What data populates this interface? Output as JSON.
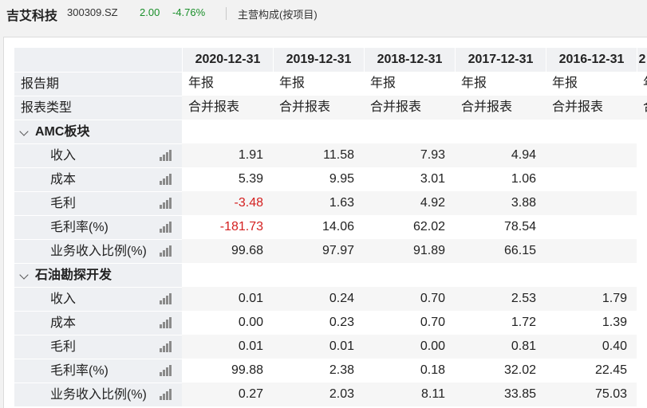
{
  "header": {
    "company": "吉艾科技",
    "code": "300309.SZ",
    "price": "2.00",
    "change": "-4.76%",
    "section": "主营构成(按项目)",
    "price_color": "#1a8f2a"
  },
  "table": {
    "periods": [
      "2020-12-31",
      "2019-12-31",
      "2018-12-31",
      "2017-12-31",
      "2016-12-31",
      "2"
    ],
    "report_period_label": "报告期",
    "report_period_values": [
      "年报",
      "年报",
      "年报",
      "年报",
      "年报",
      "年"
    ],
    "report_type_label": "报表类型",
    "report_type_values": [
      "合并报表",
      "合并报表",
      "合并报表",
      "合并报表",
      "合并报表",
      "合"
    ],
    "groups": [
      {
        "name": "AMC板块",
        "rows": [
          {
            "label": "收入",
            "values": [
              "1.91",
              "11.58",
              "7.93",
              "4.94",
              ""
            ]
          },
          {
            "label": "成本",
            "values": [
              "5.39",
              "9.95",
              "3.01",
              "1.06",
              ""
            ]
          },
          {
            "label": "毛利",
            "values": [
              "-3.48",
              "1.63",
              "4.92",
              "3.88",
              ""
            ]
          },
          {
            "label": "毛利率(%)",
            "values": [
              "-181.73",
              "14.06",
              "62.02",
              "78.54",
              ""
            ]
          },
          {
            "label": "业务收入比例(%)",
            "values": [
              "99.68",
              "97.97",
              "91.89",
              "66.15",
              ""
            ]
          }
        ]
      },
      {
        "name": "石油勘探开发",
        "rows": [
          {
            "label": "收入",
            "values": [
              "0.01",
              "0.24",
              "0.70",
              "2.53",
              "1.79"
            ]
          },
          {
            "label": "成本",
            "values": [
              "0.00",
              "0.23",
              "0.70",
              "1.72",
              "1.39"
            ]
          },
          {
            "label": "毛利",
            "values": [
              "0.01",
              "0.01",
              "0.00",
              "0.81",
              "0.40"
            ]
          },
          {
            "label": "毛利率(%)",
            "values": [
              "99.88",
              "2.38",
              "0.18",
              "32.02",
              "22.45"
            ]
          },
          {
            "label": "业务收入比例(%)",
            "values": [
              "0.27",
              "2.03",
              "8.11",
              "33.85",
              "75.03"
            ]
          }
        ]
      }
    ],
    "row_icon": "bar-chart-icon",
    "negative_color": "#d42020"
  }
}
